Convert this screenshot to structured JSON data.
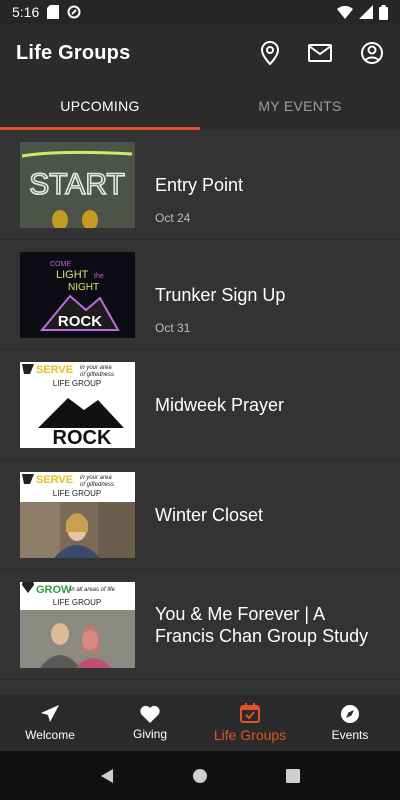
{
  "status": {
    "time": "5:16"
  },
  "app": {
    "title": "Life Groups"
  },
  "tabs": [
    {
      "label": "UPCOMING",
      "active": true
    },
    {
      "label": "MY EVENTS",
      "active": false
    }
  ],
  "events": [
    {
      "title": "Entry Point",
      "date": "Oct 24",
      "thumb_text": "START"
    },
    {
      "title": "Trunker Sign Up",
      "date": "Oct 31",
      "thumb_text": [
        "COME",
        "LIGHT",
        "the",
        "NIGHT",
        "ROCK"
      ]
    },
    {
      "title": "Midweek Prayer",
      "date": "",
      "thumb_text": [
        "SERVE",
        "in your area",
        "of giftedness",
        "LIFE GROUP",
        "ROCK"
      ]
    },
    {
      "title": "Winter Closet",
      "date": "",
      "thumb_text": [
        "SERVE",
        "in your area",
        "of giftedness",
        "LIFE GROUP"
      ]
    },
    {
      "title": "You & Me Forever | A Francis Chan Group Study",
      "date": "",
      "thumb_text": [
        "GROW",
        "in all areas of life",
        "LIFE GROUP"
      ]
    }
  ],
  "bottom_nav": [
    {
      "label": "Welcome",
      "icon": "paper-plane-icon",
      "active": false
    },
    {
      "label": "Giving",
      "icon": "heart-icon",
      "active": false
    },
    {
      "label": "Life Groups",
      "icon": "calendar-check-icon",
      "active": true
    },
    {
      "label": "Events",
      "icon": "compass-icon",
      "active": false
    }
  ],
  "colors": {
    "accent": "#e0522a",
    "background": "#333333",
    "bar": "#2b2b2b"
  }
}
